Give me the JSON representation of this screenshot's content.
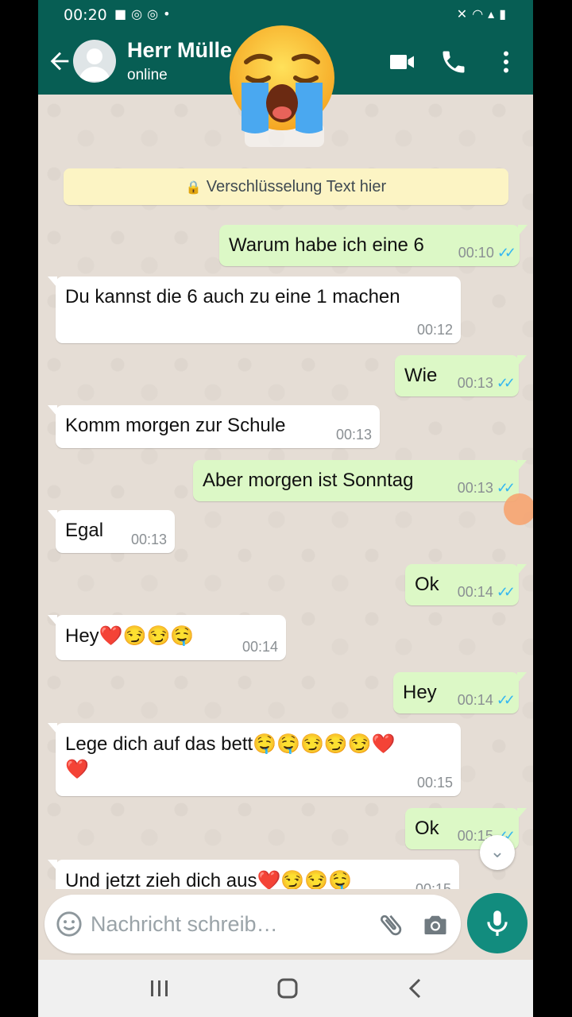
{
  "status_bar": {
    "time": "00:20",
    "left_icons": [
      "video-icon",
      "chrome-icon",
      "chrome-icon",
      "dot-icon"
    ],
    "right_icons": [
      "mute-icon",
      "wifi-icon",
      "signal-icon",
      "battery-icon"
    ]
  },
  "header": {
    "contact_name": "Herr Mülle",
    "status": "online"
  },
  "encryption_notice": "Verschlüsselung Text hier",
  "messages": [
    {
      "dir": "out",
      "text": "Warum habe ich eine 6",
      "time": "00:10"
    },
    {
      "dir": "in",
      "text": "Du kannst die 6 auch zu eine 1 machen",
      "time": "00:12"
    },
    {
      "dir": "out",
      "text": "Wie",
      "time": "00:13"
    },
    {
      "dir": "in",
      "text": "Komm morgen zur Schule",
      "time": "00:13"
    },
    {
      "dir": "out",
      "text": "Aber morgen ist Sonntag",
      "time": "00:13"
    },
    {
      "dir": "in",
      "text": "Egal",
      "time": "00:13"
    },
    {
      "dir": "out",
      "text": "Ok",
      "time": "00:14"
    },
    {
      "dir": "in",
      "text": "Hey❤️😏😏🤤",
      "time": "00:14"
    },
    {
      "dir": "out",
      "text": "Hey",
      "time": "00:14"
    },
    {
      "dir": "in",
      "text": "Lege dich auf das bett🤤🤤😏😏😏❤️",
      "text2": "❤️",
      "time": "00:15"
    },
    {
      "dir": "out",
      "text": "Ok",
      "time": "00:15"
    },
    {
      "dir": "in",
      "text": "Und jetzt zieh dich aus❤️😏😏🤤",
      "time": "00:15"
    }
  ],
  "composer": {
    "placeholder": "Nachricht schreib…"
  },
  "colors": {
    "header": "#075e54",
    "outgoing_bubble": "#dcf8c6",
    "incoming_bubble": "#ffffff",
    "mic_button": "#128c7e",
    "read_ticks": "#34b7f1"
  }
}
